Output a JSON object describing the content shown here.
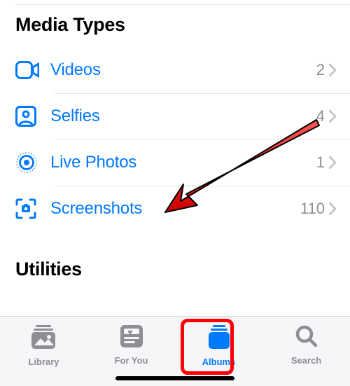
{
  "colors": {
    "link": "#007aff",
    "secondary": "#8e8e93",
    "highlight": "#ff0000"
  },
  "top_section_title": "Media Types",
  "media_rows": [
    {
      "icon": "video-camera-icon",
      "label": "Videos",
      "count": "2"
    },
    {
      "icon": "selfie-icon",
      "label": "Selfies",
      "count": "4"
    },
    {
      "icon": "live-photos-icon",
      "label": "Live Photos",
      "count": "1"
    },
    {
      "icon": "screenshot-icon",
      "label": "Screenshots",
      "count": "110"
    }
  ],
  "second_section_title": "Utilities",
  "tabs": {
    "library": "Library",
    "foryou": "For You",
    "albums": "Albums",
    "search": "Search"
  },
  "active_tab": "albums",
  "annotation": {
    "arrow_target_row_index": 3
  }
}
